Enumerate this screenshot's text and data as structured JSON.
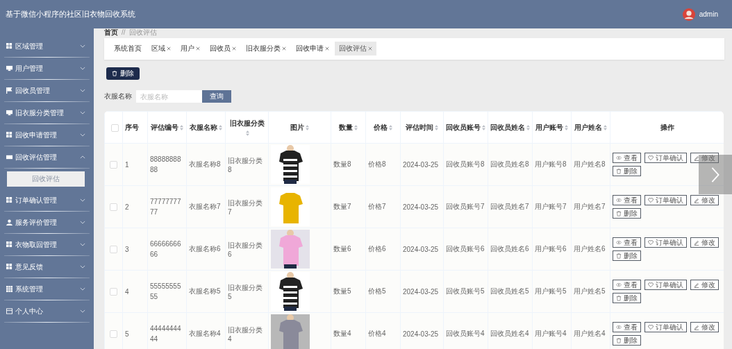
{
  "header": {
    "title": "基于微信小程序的社区旧衣物回收系统",
    "user": "admin"
  },
  "sidebar": {
    "items": [
      {
        "label": "区域管理",
        "expanded": false
      },
      {
        "label": "用户管理",
        "expanded": false
      },
      {
        "label": "回收员管理",
        "expanded": false
      },
      {
        "label": "旧衣服分类管理",
        "expanded": false
      },
      {
        "label": "回收申请管理",
        "expanded": false
      },
      {
        "label": "回收评估管理",
        "expanded": true,
        "children": [
          {
            "label": "回收评估",
            "selected": true
          }
        ]
      },
      {
        "label": "订单确认管理",
        "expanded": false
      },
      {
        "label": "服务评价管理",
        "expanded": false
      },
      {
        "label": "衣物取回管理",
        "expanded": false
      },
      {
        "label": "意见反馈",
        "expanded": false
      },
      {
        "label": "系统管理",
        "expanded": false
      },
      {
        "label": "个人中心",
        "expanded": false
      }
    ]
  },
  "breadcrumb": [
    "首页",
    "//",
    "回收评估"
  ],
  "tabs": [
    {
      "label": "系统首页",
      "closable": false,
      "selected": false
    },
    {
      "label": "区域",
      "closable": true,
      "selected": false
    },
    {
      "label": "用户",
      "closable": true,
      "selected": false
    },
    {
      "label": "回收员",
      "closable": true,
      "selected": false
    },
    {
      "label": "旧衣服分类",
      "closable": true,
      "selected": false
    },
    {
      "label": "回收申请",
      "closable": true,
      "selected": false
    },
    {
      "label": "回收评估",
      "closable": true,
      "selected": true
    }
  ],
  "toolbar": {
    "delete_button": "删除"
  },
  "search": {
    "label": "衣服名称",
    "placeholder": "衣服名称",
    "button": "查询"
  },
  "table": {
    "select_all": {
      "checked": false
    },
    "columns": [
      {
        "label": "序号",
        "sortable": false
      },
      {
        "label": "评估编号",
        "sortable": true
      },
      {
        "label": "衣服名称",
        "sortable": true
      },
      {
        "label": "旧衣服分类",
        "sortable": true
      },
      {
        "label": "图片",
        "sortable": true
      },
      {
        "label": "数量",
        "sortable": true
      },
      {
        "label": "价格",
        "sortable": true
      },
      {
        "label": "评估时间",
        "sortable": true
      },
      {
        "label": "回收员账号",
        "sortable": true
      },
      {
        "label": "回收员姓名",
        "sortable": true
      },
      {
        "label": "用户账号",
        "sortable": true
      },
      {
        "label": "用户姓名",
        "sortable": true
      },
      {
        "label": "操作",
        "sortable": false
      }
    ],
    "rows": [
      {
        "checked": false,
        "cells": [
          "1",
          "8888888888",
          "衣服名称8",
          "旧衣服分类8",
          {
            "kind": "picture"
          },
          "数量8",
          "价格8",
          "2024-03-25",
          "回收员账号8",
          "回收员姓名8",
          "用户账号8",
          "用户姓名8"
        ],
        "actions": [
          {
            "kind": "view",
            "label": "查看"
          },
          {
            "kind": "confirm",
            "label": "订单确认"
          },
          {
            "kind": "edit",
            "label": "修改"
          },
          {
            "kind": "delete",
            "label": "删除"
          }
        ]
      },
      {
        "checked": false,
        "cells": [
          "2",
          "7777777777",
          "衣服名称7",
          "旧衣服分类7",
          {
            "kind": "picture"
          },
          "数量7",
          "价格7",
          "2024-03-25",
          "回收员账号7",
          "回收员姓名7",
          "用户账号7",
          "用户姓名7"
        ],
        "actions": [
          {
            "kind": "view",
            "label": "查看"
          },
          {
            "kind": "confirm",
            "label": "订单确认"
          },
          {
            "kind": "edit",
            "label": "修改"
          },
          {
            "kind": "delete",
            "label": "删除"
          }
        ]
      },
      {
        "checked": false,
        "cells": [
          "3",
          "6666666666",
          "衣服名称6",
          "旧衣服分类6",
          {
            "kind": "picture"
          },
          "数量6",
          "价格6",
          "2024-03-25",
          "回收员账号6",
          "回收员姓名6",
          "用户账号6",
          "用户姓名6"
        ],
        "actions": [
          {
            "kind": "view",
            "label": "查看"
          },
          {
            "kind": "confirm",
            "label": "订单确认"
          },
          {
            "kind": "edit",
            "label": "修改"
          },
          {
            "kind": "delete",
            "label": "删除"
          }
        ]
      },
      {
        "checked": false,
        "cells": [
          "4",
          "5555555555",
          "衣服名称5",
          "旧衣服分类5",
          {
            "kind": "picture"
          },
          "数量5",
          "价格5",
          "2024-03-25",
          "回收员账号5",
          "回收员姓名5",
          "用户账号5",
          "用户姓名5"
        ],
        "actions": [
          {
            "kind": "view",
            "label": "查看"
          },
          {
            "kind": "confirm",
            "label": "订单确认"
          },
          {
            "kind": "edit",
            "label": "修改"
          },
          {
            "kind": "delete",
            "label": "删除"
          }
        ]
      },
      {
        "checked": false,
        "cells": [
          "5",
          "4444444444",
          "衣服名称4",
          "旧衣服分类4",
          {
            "kind": "picture"
          },
          "数量4",
          "价格4",
          "2024-03-25",
          "回收员账号4",
          "回收员姓名4",
          "用户账号4",
          "用户姓名4"
        ],
        "actions": [
          {
            "kind": "view",
            "label": "查看"
          },
          {
            "kind": "confirm",
            "label": "订单确认"
          },
          {
            "kind": "edit",
            "label": "修改"
          },
          {
            "kind": "delete",
            "label": "删除"
          }
        ]
      }
    ]
  }
}
